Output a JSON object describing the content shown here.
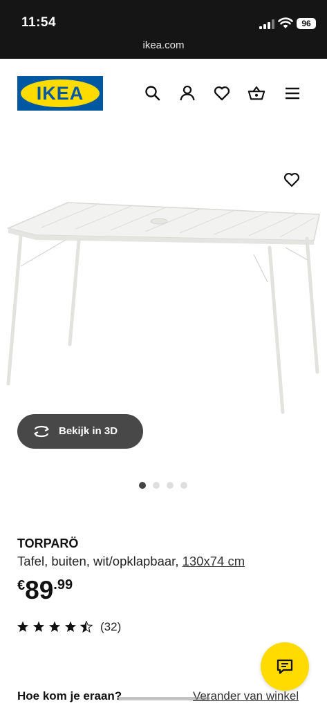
{
  "status_bar": {
    "time": "11:54",
    "battery": "96",
    "url": "ikea.com"
  },
  "header": {
    "logo_text": "IKEA",
    "icons": [
      "search-icon",
      "profile-icon",
      "favourites-icon",
      "basket-icon",
      "menu-icon"
    ]
  },
  "colors": {
    "brand_blue": "#0058a3",
    "brand_yellow": "#ffdb00",
    "button_dark": "#484848",
    "status_bar": "#151515"
  },
  "gallery": {
    "view_3d_label": "Bekijk in 3D",
    "active_dot": 0,
    "dot_count": 4
  },
  "product": {
    "name": "TORPARÖ",
    "description": "Tafel, buiten, wit/opklapbaar, ",
    "size_link": "130x74 cm",
    "currency": "€",
    "price_int": "89",
    "price_dec": ".99",
    "rating": 4.5,
    "review_count": "(32)"
  },
  "fulfillment": {
    "title": "Hoe kom je eraan?",
    "change_store": "Verander van winkel"
  }
}
